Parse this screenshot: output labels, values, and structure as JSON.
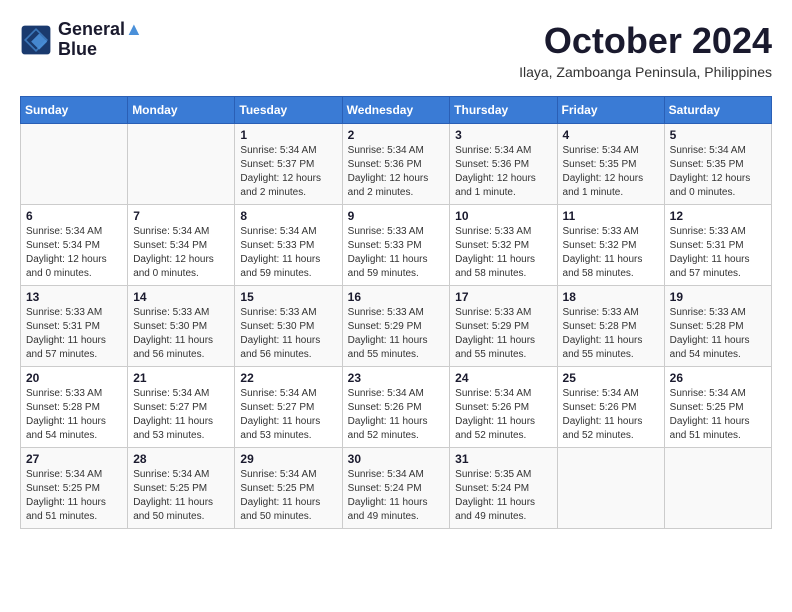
{
  "header": {
    "logo_line1": "General",
    "logo_line2": "Blue",
    "month": "October 2024",
    "location": "Ilaya, Zamboanga Peninsula, Philippines"
  },
  "days_of_week": [
    "Sunday",
    "Monday",
    "Tuesday",
    "Wednesday",
    "Thursday",
    "Friday",
    "Saturday"
  ],
  "weeks": [
    [
      {
        "day": "",
        "info": ""
      },
      {
        "day": "",
        "info": ""
      },
      {
        "day": "1",
        "info": "Sunrise: 5:34 AM\nSunset: 5:37 PM\nDaylight: 12 hours\nand 2 minutes."
      },
      {
        "day": "2",
        "info": "Sunrise: 5:34 AM\nSunset: 5:36 PM\nDaylight: 12 hours\nand 2 minutes."
      },
      {
        "day": "3",
        "info": "Sunrise: 5:34 AM\nSunset: 5:36 PM\nDaylight: 12 hours\nand 1 minute."
      },
      {
        "day": "4",
        "info": "Sunrise: 5:34 AM\nSunset: 5:35 PM\nDaylight: 12 hours\nand 1 minute."
      },
      {
        "day": "5",
        "info": "Sunrise: 5:34 AM\nSunset: 5:35 PM\nDaylight: 12 hours\nand 0 minutes."
      }
    ],
    [
      {
        "day": "6",
        "info": "Sunrise: 5:34 AM\nSunset: 5:34 PM\nDaylight: 12 hours\nand 0 minutes."
      },
      {
        "day": "7",
        "info": "Sunrise: 5:34 AM\nSunset: 5:34 PM\nDaylight: 12 hours\nand 0 minutes."
      },
      {
        "day": "8",
        "info": "Sunrise: 5:34 AM\nSunset: 5:33 PM\nDaylight: 11 hours\nand 59 minutes."
      },
      {
        "day": "9",
        "info": "Sunrise: 5:33 AM\nSunset: 5:33 PM\nDaylight: 11 hours\nand 59 minutes."
      },
      {
        "day": "10",
        "info": "Sunrise: 5:33 AM\nSunset: 5:32 PM\nDaylight: 11 hours\nand 58 minutes."
      },
      {
        "day": "11",
        "info": "Sunrise: 5:33 AM\nSunset: 5:32 PM\nDaylight: 11 hours\nand 58 minutes."
      },
      {
        "day": "12",
        "info": "Sunrise: 5:33 AM\nSunset: 5:31 PM\nDaylight: 11 hours\nand 57 minutes."
      }
    ],
    [
      {
        "day": "13",
        "info": "Sunrise: 5:33 AM\nSunset: 5:31 PM\nDaylight: 11 hours\nand 57 minutes."
      },
      {
        "day": "14",
        "info": "Sunrise: 5:33 AM\nSunset: 5:30 PM\nDaylight: 11 hours\nand 56 minutes."
      },
      {
        "day": "15",
        "info": "Sunrise: 5:33 AM\nSunset: 5:30 PM\nDaylight: 11 hours\nand 56 minutes."
      },
      {
        "day": "16",
        "info": "Sunrise: 5:33 AM\nSunset: 5:29 PM\nDaylight: 11 hours\nand 55 minutes."
      },
      {
        "day": "17",
        "info": "Sunrise: 5:33 AM\nSunset: 5:29 PM\nDaylight: 11 hours\nand 55 minutes."
      },
      {
        "day": "18",
        "info": "Sunrise: 5:33 AM\nSunset: 5:28 PM\nDaylight: 11 hours\nand 55 minutes."
      },
      {
        "day": "19",
        "info": "Sunrise: 5:33 AM\nSunset: 5:28 PM\nDaylight: 11 hours\nand 54 minutes."
      }
    ],
    [
      {
        "day": "20",
        "info": "Sunrise: 5:33 AM\nSunset: 5:28 PM\nDaylight: 11 hours\nand 54 minutes."
      },
      {
        "day": "21",
        "info": "Sunrise: 5:34 AM\nSunset: 5:27 PM\nDaylight: 11 hours\nand 53 minutes."
      },
      {
        "day": "22",
        "info": "Sunrise: 5:34 AM\nSunset: 5:27 PM\nDaylight: 11 hours\nand 53 minutes."
      },
      {
        "day": "23",
        "info": "Sunrise: 5:34 AM\nSunset: 5:26 PM\nDaylight: 11 hours\nand 52 minutes."
      },
      {
        "day": "24",
        "info": "Sunrise: 5:34 AM\nSunset: 5:26 PM\nDaylight: 11 hours\nand 52 minutes."
      },
      {
        "day": "25",
        "info": "Sunrise: 5:34 AM\nSunset: 5:26 PM\nDaylight: 11 hours\nand 52 minutes."
      },
      {
        "day": "26",
        "info": "Sunrise: 5:34 AM\nSunset: 5:25 PM\nDaylight: 11 hours\nand 51 minutes."
      }
    ],
    [
      {
        "day": "27",
        "info": "Sunrise: 5:34 AM\nSunset: 5:25 PM\nDaylight: 11 hours\nand 51 minutes."
      },
      {
        "day": "28",
        "info": "Sunrise: 5:34 AM\nSunset: 5:25 PM\nDaylight: 11 hours\nand 50 minutes."
      },
      {
        "day": "29",
        "info": "Sunrise: 5:34 AM\nSunset: 5:25 PM\nDaylight: 11 hours\nand 50 minutes."
      },
      {
        "day": "30",
        "info": "Sunrise: 5:34 AM\nSunset: 5:24 PM\nDaylight: 11 hours\nand 49 minutes."
      },
      {
        "day": "31",
        "info": "Sunrise: 5:35 AM\nSunset: 5:24 PM\nDaylight: 11 hours\nand 49 minutes."
      },
      {
        "day": "",
        "info": ""
      },
      {
        "day": "",
        "info": ""
      }
    ]
  ]
}
